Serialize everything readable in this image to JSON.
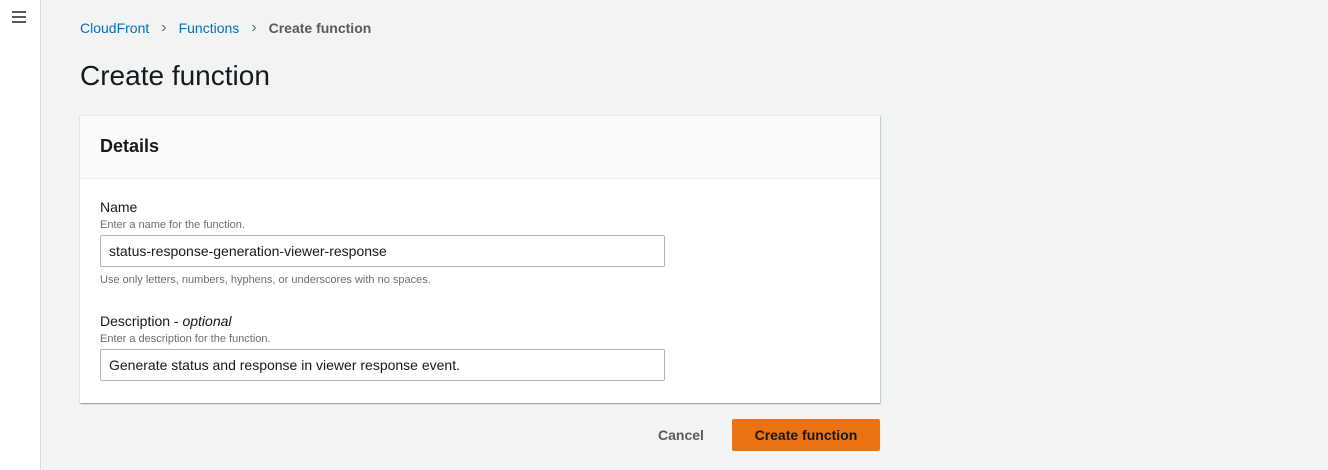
{
  "breadcrumb": {
    "items": [
      "CloudFront",
      "Functions"
    ],
    "current": "Create function"
  },
  "page_title": "Create function",
  "details": {
    "title": "Details",
    "name": {
      "label": "Name",
      "help": "Enter a name for the function.",
      "value": "status-response-generation-viewer-response",
      "constraint": "Use only letters, numbers, hyphens, or underscores with no spaces."
    },
    "description": {
      "label": "Description - ",
      "optional": "optional",
      "help": "Enter a description for the function.",
      "value": "Generate status and response in viewer response event."
    }
  },
  "actions": {
    "cancel": "Cancel",
    "create": "Create function"
  },
  "colors": {
    "accent": "#ec7211",
    "link": "#0073bb"
  }
}
